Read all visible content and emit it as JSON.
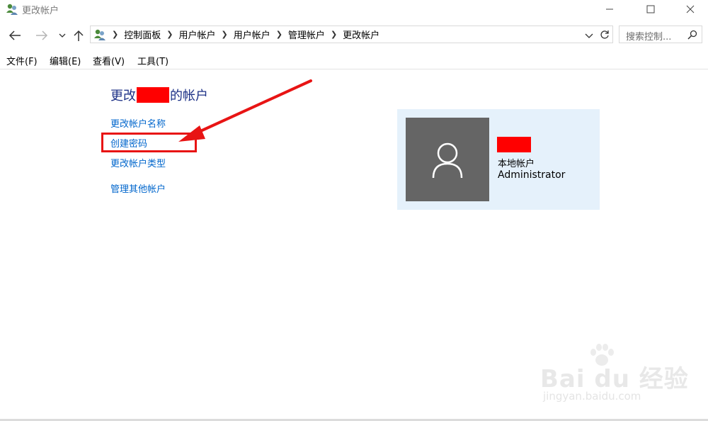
{
  "window": {
    "title": "更改帐户"
  },
  "address_bar": {
    "breadcrumbs": [
      "控制面板",
      "用户帐户",
      "用户帐户",
      "管理帐户",
      "更改帐户"
    ]
  },
  "search": {
    "placeholder": "搜索控制..."
  },
  "menu": [
    "文件(F)",
    "编辑(E)",
    "查看(V)",
    "工具(T)"
  ],
  "main": {
    "heading_prefix": "更改",
    "heading_suffix": "的帐户",
    "tasks": [
      "更改帐户名称",
      "创建密码",
      "更改帐户类型"
    ],
    "other_link": "管理其他帐户"
  },
  "account_card": {
    "type": "本地帐户",
    "group": "Administrator"
  },
  "watermark": {
    "main": "Bai du 经验",
    "url": "jingyan.baidu.com"
  },
  "colors": {
    "link": "#0066cc",
    "heading": "#1e3287",
    "annotation": "#e81414",
    "card_bg": "#e5f1fb",
    "avatar_bg": "#656565"
  }
}
